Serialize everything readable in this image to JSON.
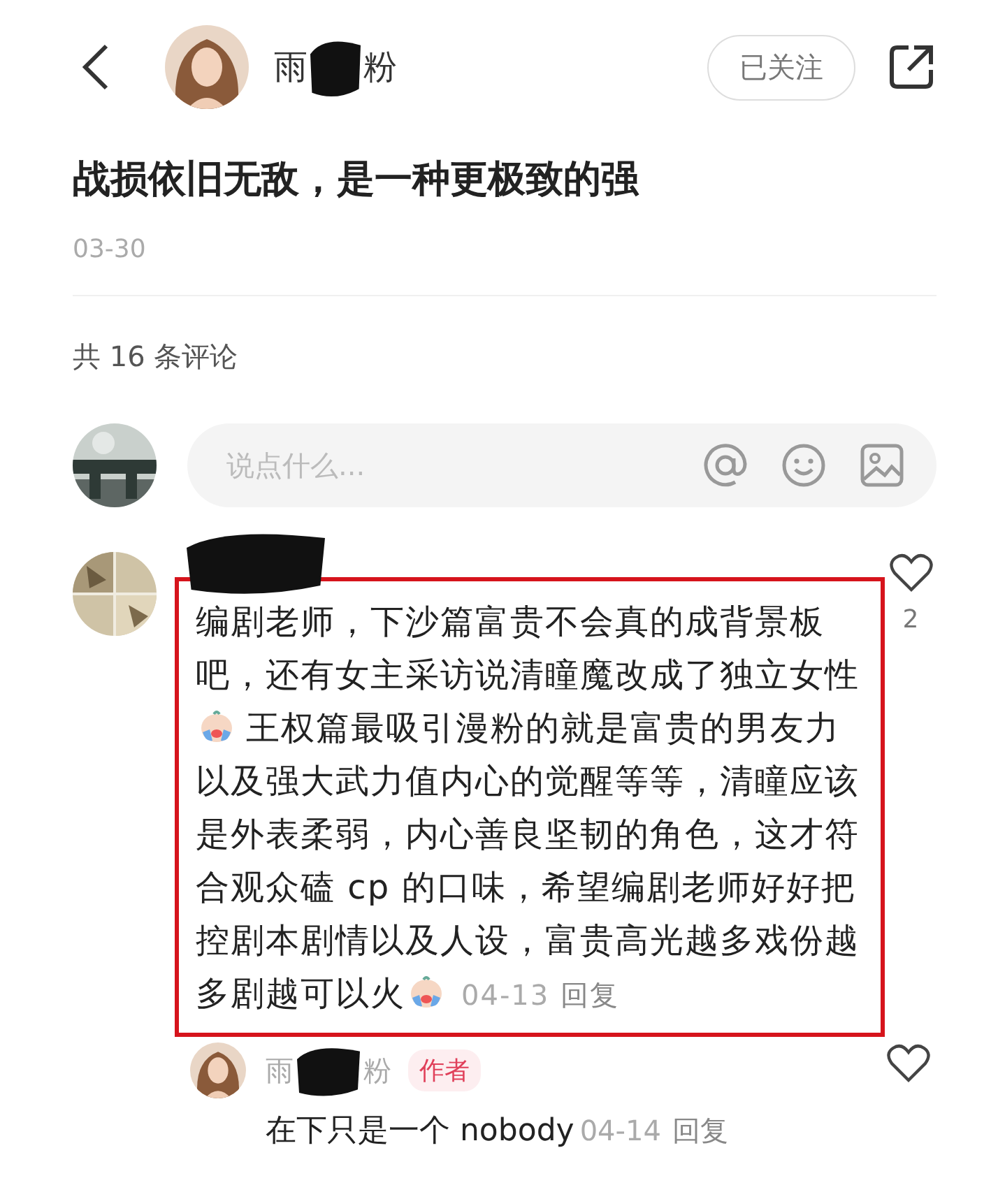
{
  "header": {
    "author_name_start": "雨",
    "author_name_end": "粉",
    "name_redacted": true,
    "follow_button": "已关注"
  },
  "post": {
    "title": "战损依旧无敌，是一种更极致的强",
    "date": "03-30"
  },
  "comment_count": "共 16 条评论",
  "comment_input": {
    "placeholder": "说点什么..."
  },
  "comments": [
    {
      "name_redacted": true,
      "highlighted": true,
      "likes": "2",
      "segments": [
        {
          "kind": "text",
          "text": "编剧老师，下沙篇富贵不会真的成背景板吧，还有女主采访说清瞳魔改成了独立女性"
        },
        {
          "kind": "emoji"
        },
        {
          "kind": "text",
          "text": "王权篇最吸引漫粉的就是富贵的男友力以及强大武力值内心的觉醒等等，清瞳应该是外表柔弱，内心善良坚韧的角色，这才符合观众磕 cp 的口味，希望编剧老师好好把控剧本剧情以及人设，富贵高光越多戏份越多剧越可以火"
        },
        {
          "kind": "emoji"
        }
      ],
      "date": "04-13",
      "reply": "回复",
      "replies": [
        {
          "name_start": "雨",
          "name_end": "粉",
          "name_redacted": true,
          "badge": "作者",
          "text": "在下只是一个 nobody",
          "date": "04-14",
          "reply": "回复"
        }
      ]
    }
  ]
}
